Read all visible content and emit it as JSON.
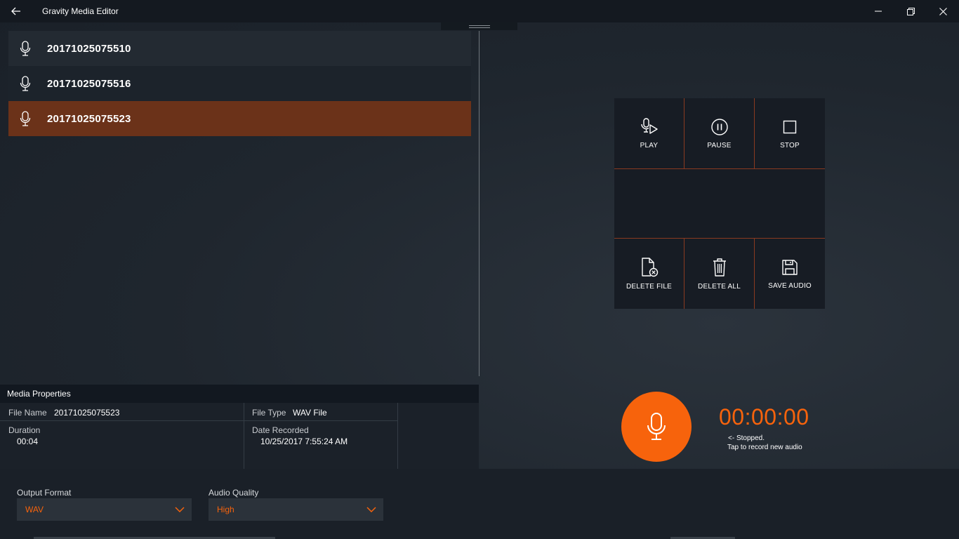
{
  "titlebar": {
    "title": "Gravity Media Editor",
    "back_icon": "arrow-left-icon",
    "window_controls": [
      "minimize-icon",
      "restore-icon",
      "close-icon"
    ]
  },
  "recordings": [
    {
      "name": "20171025075510",
      "icon": "microphone-icon",
      "selected": false
    },
    {
      "name": "20171025075516",
      "icon": "microphone-icon",
      "selected": false
    },
    {
      "name": "20171025075523",
      "icon": "microphone-icon",
      "selected": true
    }
  ],
  "controls": {
    "play": "PLAY",
    "pause": "PAUSE",
    "stop": "STOP",
    "delete_file": "DELETE FILE",
    "delete_all": "DELETE ALL",
    "save_audio": "SAVE AUDIO"
  },
  "properties": {
    "header": "Media Properties",
    "file_name_label": "File Name",
    "file_name": "20171025075523",
    "file_type_label": "File Type",
    "file_type": "WAV File",
    "duration_label": "Duration",
    "duration": "00:04",
    "date_label": "Date Recorded",
    "date": "10/25/2017 7:55:24 AM"
  },
  "recorder": {
    "timer": "00:00:00",
    "status_line1": "<- Stopped.",
    "status_line2": "Tap to record new audio"
  },
  "settings": {
    "output_format_label": "Output Format",
    "output_format_value": "WAV",
    "audio_quality_label": "Audio Quality",
    "audio_quality_value": "High"
  },
  "colors": {
    "accent": "#f7630c",
    "selected_row": "#6b3219",
    "divider": "#8a3a20"
  }
}
